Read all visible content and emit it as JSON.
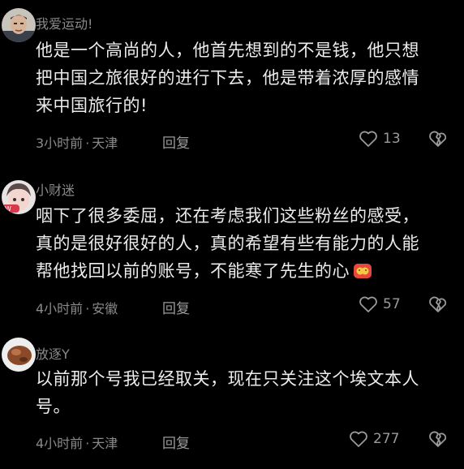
{
  "comments": [
    {
      "username": "我爱运动!",
      "lines": [
        "他是一个高尚的人，他首先想到的不是钱，他只想",
        "把中国之旅很好的进行下去，他是带着浓厚的感情",
        "来中国旅行的!"
      ],
      "time": "3小时前",
      "location": "天津",
      "reply_label": "回复",
      "likes": "13"
    },
    {
      "username": "小财迷",
      "lines": [
        "咽下了很多委屈，还在考虑我们这些粉丝的感受，",
        "真的是很好很好的人，真的希望有些有能力的人能",
        "帮他找回以前的账号，不能寒了先生的心"
      ],
      "time": "4小时前",
      "location": "安徽",
      "reply_label": "回复",
      "likes": "57"
    },
    {
      "username": "放逐Y",
      "lines": [
        "以前那个号我已经取关，现在只关注这个埃文本人",
        "号。"
      ],
      "time": "4小时前",
      "location": "天津",
      "reply_label": "回复",
      "likes": "277"
    }
  ],
  "separator": "·",
  "colors": {
    "background": "#000000",
    "text": "#ececec",
    "muted": "#8a8a8a"
  },
  "icons": [
    "heart-outline-icon",
    "broken-heart-icon",
    "emoji-icon"
  ]
}
